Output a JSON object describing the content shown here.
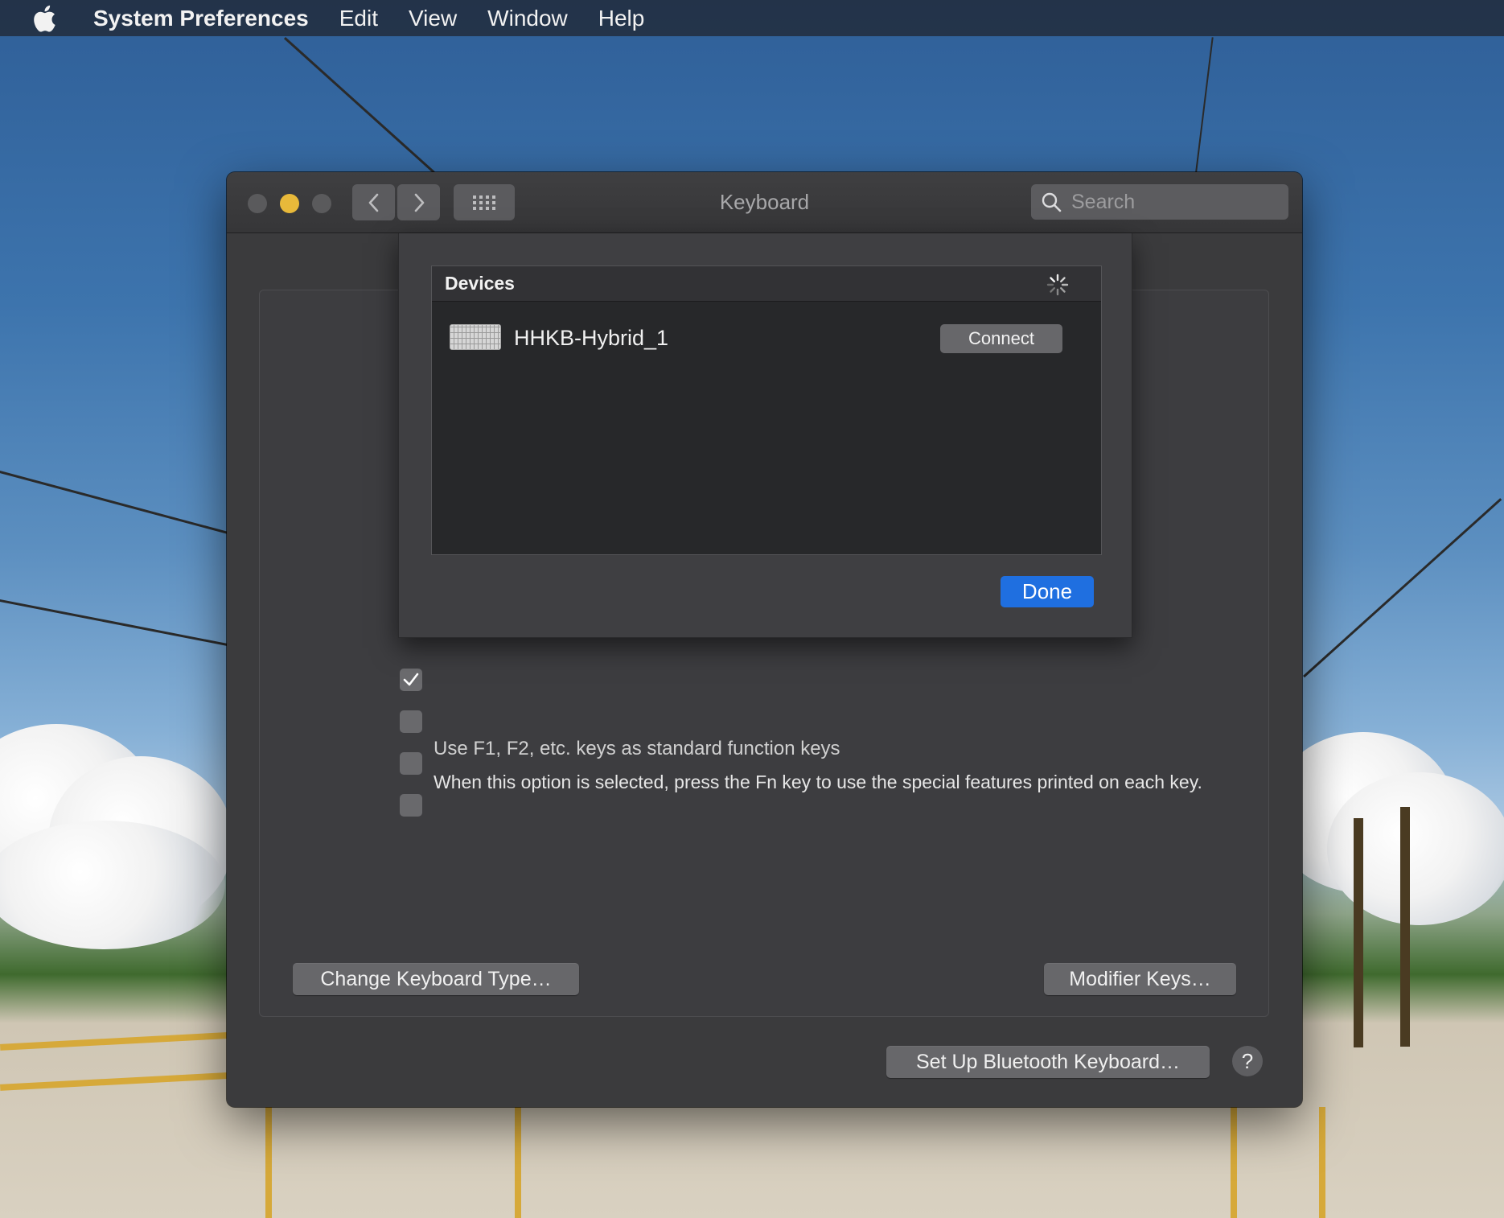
{
  "menubar": {
    "app_name": "System Preferences",
    "items": [
      "Edit",
      "View",
      "Window",
      "Help"
    ]
  },
  "window": {
    "title": "Keyboard",
    "search": {
      "placeholder": "Search"
    }
  },
  "options": {
    "checkboxes": [
      {
        "checked": true
      },
      {
        "checked": false
      },
      {
        "checked": false
      },
      {
        "checked": false
      }
    ],
    "partially_hidden_label": "Use F1, F2, etc. keys as standard function keys",
    "description": "When this option is selected, press the Fn key to use the special features printed on each key."
  },
  "buttons": {
    "change_keyboard_type": "Change Keyboard Type…",
    "modifier_keys": "Modifier Keys…",
    "setup_bluetooth": "Set Up Bluetooth Keyboard…",
    "help": "?"
  },
  "sheet": {
    "devices_header": "Devices",
    "devices": [
      {
        "name": "HHKB-Hybrid_1",
        "icon": "keyboard-icon",
        "action": "Connect"
      }
    ],
    "done_label": "Done"
  },
  "colors": {
    "accent_blue": "#1f6fe0",
    "traffic_minimize": "#e8b93a",
    "window_bg": "#3b3b3d"
  }
}
